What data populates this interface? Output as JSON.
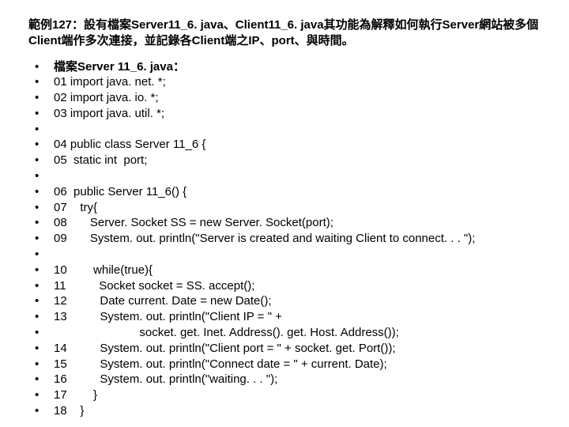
{
  "title_parts": {
    "p1": "範例127：設有檔案Server11_6. java、Client11_6. java其功能為解釋",
    "p2": "如何執行Server網站被多個Client端作多次連接，並記錄各Client端之IP、port、與時間。"
  },
  "lines": [
    {
      "text": "檔案Server 11_6. java：",
      "bold": true
    },
    {
      "text": "01 import java. net. *;"
    },
    {
      "text": "02 import java. io. *;"
    },
    {
      "text": "03 import java. util. *;"
    },
    {
      "text": ""
    },
    {
      "text": "04 public class Server 11_6 {"
    },
    {
      "text": "05  static int  port;"
    },
    {
      "text": ""
    },
    {
      "text": "06  public Server 11_6() {"
    },
    {
      "text": "07    try{"
    },
    {
      "text": "08       Server. Socket SS = new Server. Socket(port);"
    },
    {
      "text": "09       System. out. println(\"Server is created and waiting Client to connect. . . \");"
    },
    {
      "text": ""
    },
    {
      "text": "10        while(true){"
    },
    {
      "text": "11          Socket socket = SS. accept();"
    },
    {
      "text": "12          Date current. Date = new Date();"
    },
    {
      "text": "13          System. out. println(\"Client IP = \" +"
    },
    {
      "text": "                          socket. get. Inet. Address(). get. Host. Address());"
    },
    {
      "text": "14          System. out. println(\"Client port = \" + socket. get. Port());"
    },
    {
      "text": "15          System. out. println(\"Connect date = \" + current. Date);"
    },
    {
      "text": "16          System. out. println(\"waiting. . . \");"
    },
    {
      "text": "17        }"
    },
    {
      "text": "18    }"
    }
  ]
}
